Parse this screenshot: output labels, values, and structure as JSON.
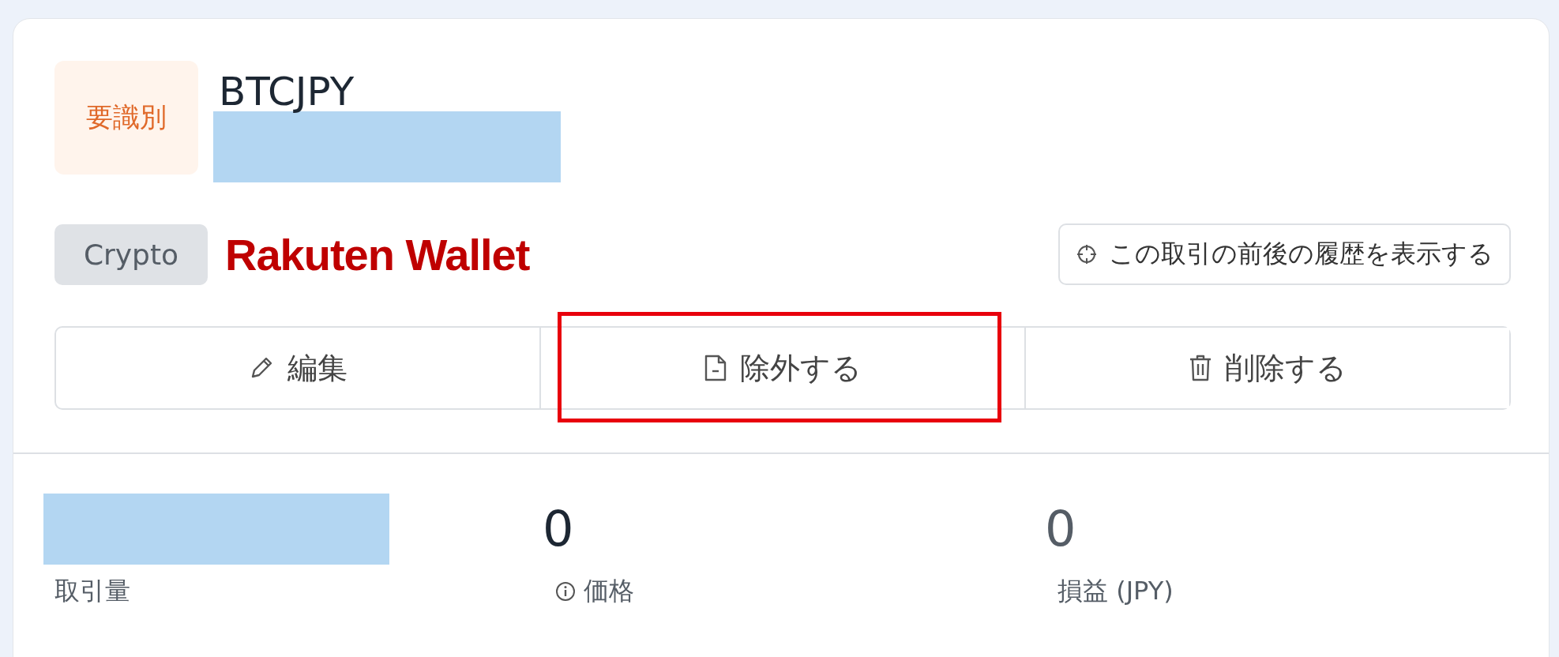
{
  "card": {
    "status_badge": "要識別",
    "title": "BTCJPY",
    "subtitle_redacted": true,
    "category_badge": "Crypto",
    "exchange_logo": "Rakuten Wallet",
    "history_button": "この取引の前後の履歴を表示する"
  },
  "actions": [
    {
      "kind": "edit",
      "label": "編集",
      "highlighted": false
    },
    {
      "kind": "exclude",
      "label": "除外する",
      "highlighted": true
    },
    {
      "kind": "delete",
      "label": "削除する",
      "highlighted": false
    }
  ],
  "stats": [
    {
      "value_redacted": true,
      "label": "取引量",
      "info": false
    },
    {
      "value": "0",
      "label": "価格",
      "info": true
    },
    {
      "value": "0",
      "label": "損益 (JPY)",
      "info": false
    }
  ]
}
